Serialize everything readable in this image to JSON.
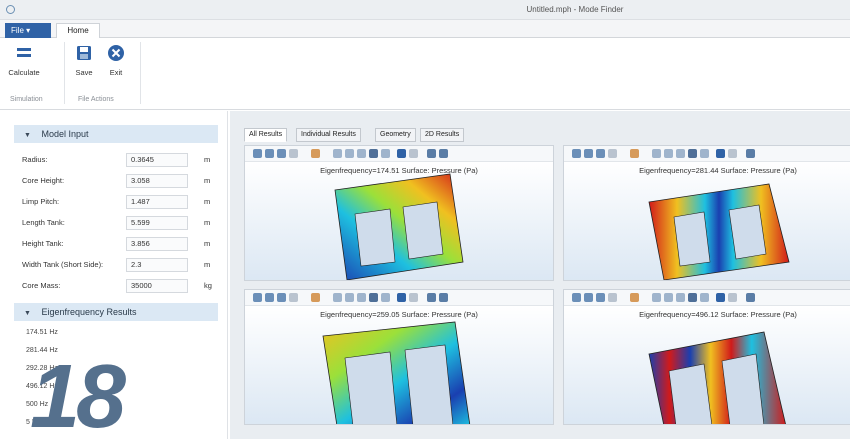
{
  "window": {
    "title": "Untitled.mph - Mode Finder"
  },
  "ribbon": {
    "file_tab": "File ▾",
    "home_tab": "Home",
    "buttons": {
      "calculate": "Calculate",
      "save": "Save",
      "exit": "Exit"
    },
    "groups": {
      "simulation": "Simulation",
      "file_actions": "File Actions"
    }
  },
  "model_input": {
    "header": "Model Input",
    "rows": [
      {
        "label": "Radius:",
        "value": "0.3645",
        "unit": "m"
      },
      {
        "label": "Core Height:",
        "value": "3.058",
        "unit": "m"
      },
      {
        "label": "Limp Pitch:",
        "value": "1.487",
        "unit": "m"
      },
      {
        "label": "Length Tank:",
        "value": "5.599",
        "unit": "m"
      },
      {
        "label": "Height Tank:",
        "value": "3.856",
        "unit": "m"
      },
      {
        "label": "Width Tank (Short Side):",
        "value": "2.3",
        "unit": "m"
      },
      {
        "label": "Core Mass:",
        "value": "35000",
        "unit": "kg"
      }
    ]
  },
  "eigen_results": {
    "header": "Eigenfrequency Results",
    "items": [
      "174.51 Hz",
      "281.44 Hz",
      "292.28 Hz",
      "496.12 Hz",
      "500 Hz",
      "5 Hz"
    ]
  },
  "overlay": {
    "number": "18"
  },
  "result_tabs": [
    "All Results",
    "Individual Results",
    "Geometry",
    "2D Results"
  ],
  "plots": [
    {
      "title": "Eigenfrequency=174.51  Surface: Pressure (Pa)",
      "mode": 1
    },
    {
      "title": "Eigenfrequency=281.44  Surface: Pressure (Pa)",
      "mode": 2
    },
    {
      "title": "Eigenfrequency=259.05  Surface: Pressure (Pa)",
      "mode": 3
    },
    {
      "title": "Eigenfrequency=496.12  Surface: Pressure (Pa)",
      "mode": 4
    }
  ],
  "colors": {
    "accent": "#2f62a6",
    "section_header": "#dbe8f4",
    "overlay": "#55708d"
  },
  "icons": {
    "calculate": "equals-icon",
    "save": "floppy-icon",
    "exit": "close-circle-icon"
  }
}
